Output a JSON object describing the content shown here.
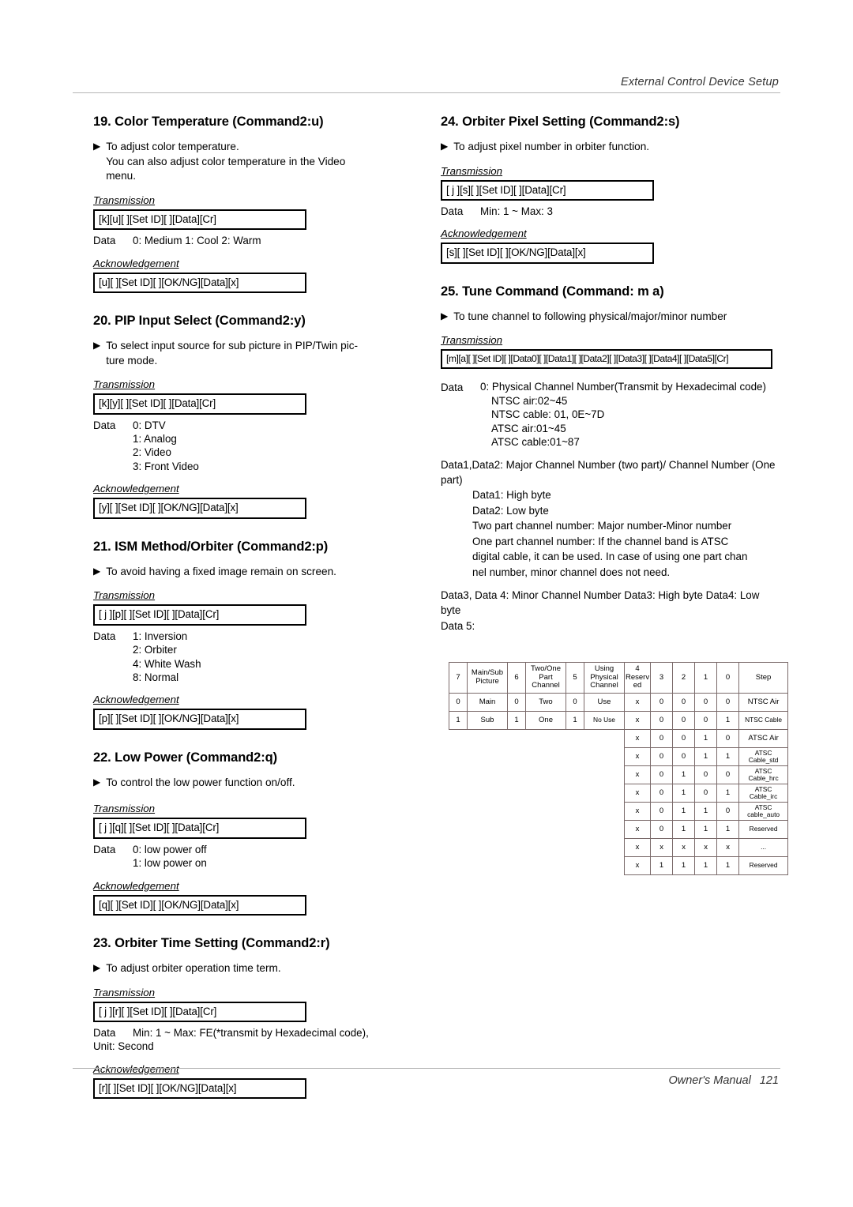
{
  "header": {
    "title": "External Control Device Setup"
  },
  "footer": {
    "manual": "Owner's Manual",
    "page": "121"
  },
  "icons": {
    "triangle": "▶"
  },
  "labels": {
    "transmission": "Transmission",
    "acknowledgement": "Acknowledgement",
    "data": "Data"
  },
  "sections": {
    "s19": {
      "title": "19. Color Temperature (Command2:u)",
      "desc_line1": "To adjust color temperature.",
      "desc_line2": "You can also adjust color temperature in the Video",
      "desc_line3": "menu.",
      "transmission": "Transmission",
      "tx_box": "[k][u][  ][Set ID][  ][Data][Cr]",
      "data_label": "Data",
      "data_values": "0: Medium    1: Cool    2: Warm",
      "ack_label": "Acknowledgement",
      "ack_box": "[u][  ][Set ID][  ][OK/NG][Data][x]"
    },
    "s20": {
      "title": "20. PIP Input Select (Command2:y)",
      "desc_line1": "To select input source for sub picture in PIP/Twin pic-",
      "desc_line2": "ture mode.",
      "transmission": "Transmission",
      "tx_box": "[k][y][  ][Set ID][  ][Data][Cr]",
      "data_label": "Data",
      "data_values": [
        "0: DTV",
        "1: Analog",
        "2: Video",
        "3: Front Video"
      ],
      "ack_label": "Acknowledgement",
      "ack_box": "[y][  ][Set ID][  ][OK/NG][Data][x]"
    },
    "s21": {
      "title": "21. ISM Method/Orbiter (Command2:p)",
      "desc_line1": "To avoid having a fixed image remain on screen.",
      "transmission": "Transmission",
      "tx_box": "[ j ][p][  ][Set ID][  ][Data][Cr]",
      "data_label": "Data",
      "data_values": [
        "1: Inversion",
        "2: Orbiter",
        "4: White Wash",
        "8: Normal"
      ],
      "ack_label": "Acknowledgement",
      "ack_box": "[p][  ][Set ID][  ][OK/NG][Data][x]"
    },
    "s22": {
      "title": "22. Low Power (Command2:q)",
      "desc_line1": "To control the low power function on/off.",
      "transmission": "Transmission",
      "tx_box": "[ j ][q][  ][Set ID][  ][Data][Cr]",
      "data_label": "Data",
      "data_values": [
        "0: low power off",
        "1: low power on"
      ],
      "ack_label": "Acknowledgement",
      "ack_box": "[q][  ][Set ID][  ][OK/NG][Data][x]"
    },
    "s23": {
      "title": "23. Orbiter Time Setting (Command2:r)",
      "desc_line1": "To adjust orbiter operation time term.",
      "transmission": "Transmission",
      "tx_box": "[ j ][r][  ][Set ID][  ][Data][Cr]",
      "data_label": "Data",
      "data_values_line1": "Min: 1 ~ Max: FE(*transmit by Hexadecimal code),",
      "data_values_line2": "Unit: Second",
      "ack_label": "Acknowledgement",
      "ack_box": "[r][  ][Set ID][  ][OK/NG][Data][x]"
    },
    "s24": {
      "title": "24. Orbiter Pixel Setting (Command2:s)",
      "desc_line1": "To adjust pixel number in orbiter function.",
      "transmission": "Transmission",
      "tx_box": "[ j ][s][  ][Set ID][  ][Data][Cr]",
      "data_label": "Data",
      "data_values": "Min: 1 ~ Max: 3",
      "ack_label": "Acknowledgement",
      "ack_box": "[s][  ][Set ID][  ][OK/NG][Data][x]"
    },
    "s25": {
      "title": "25. Tune Command (Command: m a)",
      "desc_line1": "To tune channel to following physical/major/minor number",
      "transmission": "Transmission",
      "tx_box": "[m][a][  ][Set ID][  ][Data0][  ][Data1][  ][Data2][  ][Data3][  ][Data4][  ][Data5][Cr]",
      "data_label": "Data",
      "data0_title": "0: Physical Channel Number(Transmit by Hexadecimal code)",
      "data0_items": [
        "NTSC air:02~45",
        "NTSC cable: 01, 0E~7D",
        "ATSC air:01~45",
        "ATSC cable:01~87"
      ],
      "data12_title": "Data1,Data2: Major Channel Number (two part)/ Channel Number (One part)",
      "data12_items": [
        "Data1: High byte",
        "Data2: Low byte",
        "Two part channel number: Major number-Minor number",
        "One part channel number: If the channel band is ATSC",
        "digital cable, it can be used. In case of using one part chan",
        "nel number, minor channel does not need."
      ],
      "data34_line": "Data3, Data 4: Minor Channel Number Data3: High byte Data4: Low byte",
      "data5_label": "Data   5:"
    }
  },
  "bit_table": {
    "headers": {
      "bit7": "7",
      "name7": "Main/Sub Picture",
      "bit6": "6",
      "name6": "Two/One Part Channel",
      "bit5": "5",
      "name5": "Using Physical Channel",
      "bit4": "4 Reserv ed",
      "bit3": "3",
      "bit2": "2",
      "bit1": "1",
      "bit0": "0",
      "step": "Step"
    },
    "rows": [
      {
        "b7": "0",
        "n7": "Main",
        "b6": "0",
        "n6": "Two",
        "b5": "0",
        "n5": "Use",
        "b4": "x",
        "b3": "0",
        "b2": "0",
        "b1": "0",
        "b0": "0",
        "step": "NTSC Air"
      },
      {
        "b7": "1",
        "n7": "Sub",
        "b6": "1",
        "n6": "One",
        "b5": "1",
        "n5": "No Use",
        "b4": "x",
        "b3": "0",
        "b2": "0",
        "b1": "0",
        "b0": "1",
        "step": "NTSC Cable"
      },
      {
        "b7": "",
        "n7": "",
        "b6": "",
        "n6": "",
        "b5": "",
        "n5": "",
        "b4": "x",
        "b3": "0",
        "b2": "0",
        "b1": "1",
        "b0": "0",
        "step": "ATSC Air"
      },
      {
        "b7": "",
        "n7": "",
        "b6": "",
        "n6": "",
        "b5": "",
        "n5": "",
        "b4": "x",
        "b3": "0",
        "b2": "0",
        "b1": "1",
        "b0": "1",
        "step": "ATSC Cable_std"
      },
      {
        "b7": "",
        "n7": "",
        "b6": "",
        "n6": "",
        "b5": "",
        "n5": "",
        "b4": "x",
        "b3": "0",
        "b2": "1",
        "b1": "0",
        "b0": "0",
        "step": "ATSC Cable_hrc"
      },
      {
        "b7": "",
        "n7": "",
        "b6": "",
        "n6": "",
        "b5": "",
        "n5": "",
        "b4": "x",
        "b3": "0",
        "b2": "1",
        "b1": "0",
        "b0": "1",
        "step": "ATSC Cable_irc"
      },
      {
        "b7": "",
        "n7": "",
        "b6": "",
        "n6": "",
        "b5": "",
        "n5": "",
        "b4": "x",
        "b3": "0",
        "b2": "1",
        "b1": "1",
        "b0": "0",
        "step": "ATSC cable_auto"
      },
      {
        "b7": "",
        "n7": "",
        "b6": "",
        "n6": "",
        "b5": "",
        "n5": "",
        "b4": "x",
        "b3": "0",
        "b2": "1",
        "b1": "1",
        "b0": "1",
        "step": "Reserved"
      },
      {
        "b7": "",
        "n7": "",
        "b6": "",
        "n6": "",
        "b5": "",
        "n5": "",
        "b4": "x",
        "b3": "x",
        "b2": "x",
        "b1": "x",
        "b0": "x",
        "step": "..."
      },
      {
        "b7": "",
        "n7": "",
        "b6": "",
        "n6": "",
        "b5": "",
        "n5": "",
        "b4": "x",
        "b3": "1",
        "b2": "1",
        "b1": "1",
        "b0": "1",
        "step": "Reserved"
      }
    ]
  }
}
